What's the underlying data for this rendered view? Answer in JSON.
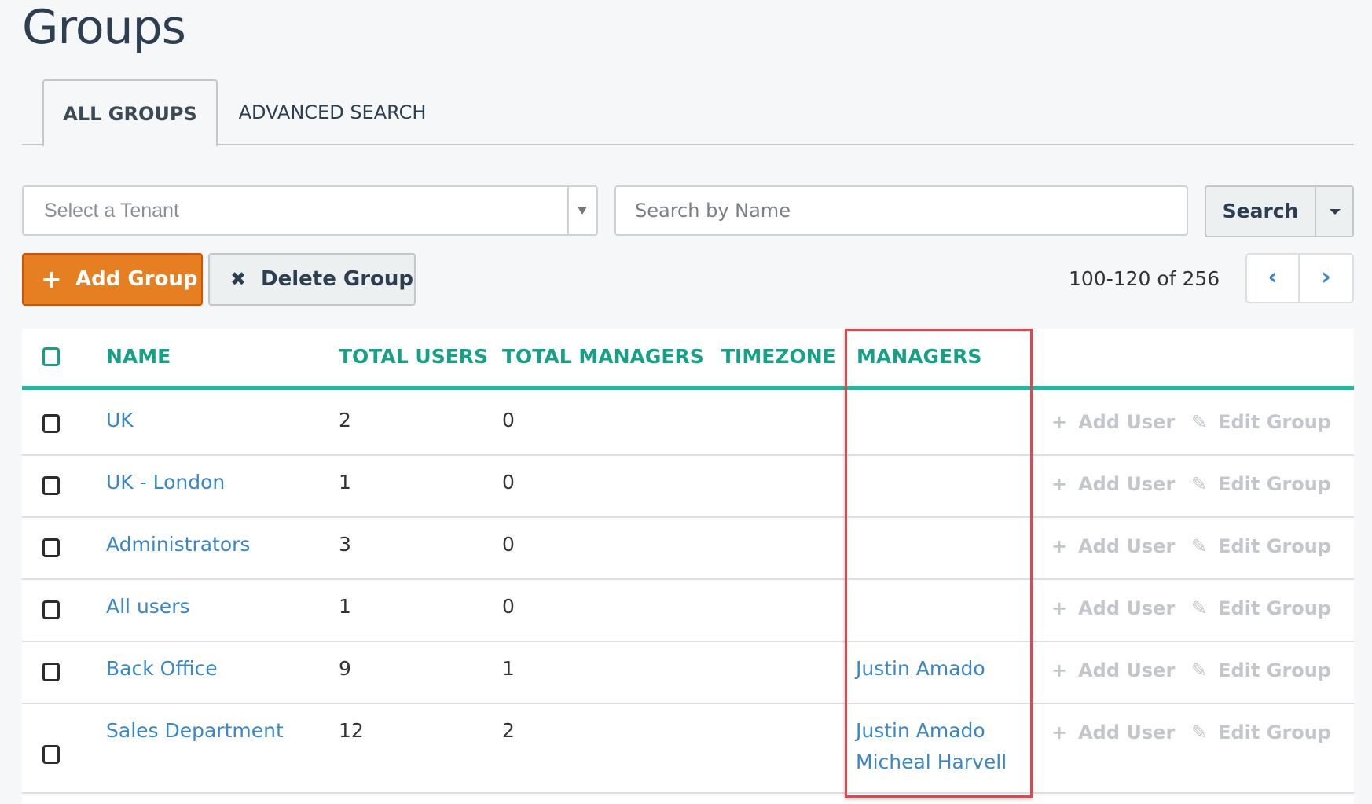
{
  "page": {
    "title": "Groups"
  },
  "tabs": [
    {
      "label": "ALL GROUPS",
      "active": true
    },
    {
      "label": "ADVANCED SEARCH",
      "active": false
    }
  ],
  "filters": {
    "tenant_placeholder": "Select a Tenant",
    "name_placeholder": "Search by Name",
    "name_value": "",
    "search_label": "Search"
  },
  "actions": {
    "add_group_label": "Add Group",
    "add_group_icon": "+",
    "delete_group_label": "Delete Group",
    "delete_group_icon": "✖"
  },
  "pagination": {
    "range_text": "100-120 of 256",
    "prev_icon": "‹",
    "next_icon": "›"
  },
  "table": {
    "headers": {
      "name": "NAME",
      "total_users": "TOTAL USERS",
      "total_managers": "TOTAL MANAGERS",
      "timezone": "TIMEZONE",
      "managers": "MANAGERS"
    },
    "row_actions": {
      "add_user_label": "Add User",
      "add_user_icon": "+",
      "edit_group_label": "Edit Group",
      "edit_group_icon": "✎"
    },
    "rows": [
      {
        "name": "UK",
        "total_users": "2",
        "total_managers": "0",
        "timezone": "",
        "managers": []
      },
      {
        "name": "UK - London",
        "total_users": "1",
        "total_managers": "0",
        "timezone": "",
        "managers": []
      },
      {
        "name": "Administrators",
        "total_users": "3",
        "total_managers": "0",
        "timezone": "",
        "managers": []
      },
      {
        "name": "All users",
        "total_users": "1",
        "total_managers": "0",
        "timezone": "",
        "managers": []
      },
      {
        "name": "Back Office",
        "total_users": "9",
        "total_managers": "1",
        "timezone": "",
        "managers": [
          "Justin Amado"
        ]
      },
      {
        "name": "Sales Department",
        "total_users": "12",
        "total_managers": "2",
        "timezone": "",
        "managers": [
          "Justin Amado",
          "Micheal Harvell"
        ]
      }
    ]
  },
  "colors": {
    "accent_teal": "#1abc9c",
    "header_text": "#16a085",
    "link_blue": "#3a87c8",
    "primary_orange": "#e67e22",
    "highlight_red": "#e8434b"
  }
}
